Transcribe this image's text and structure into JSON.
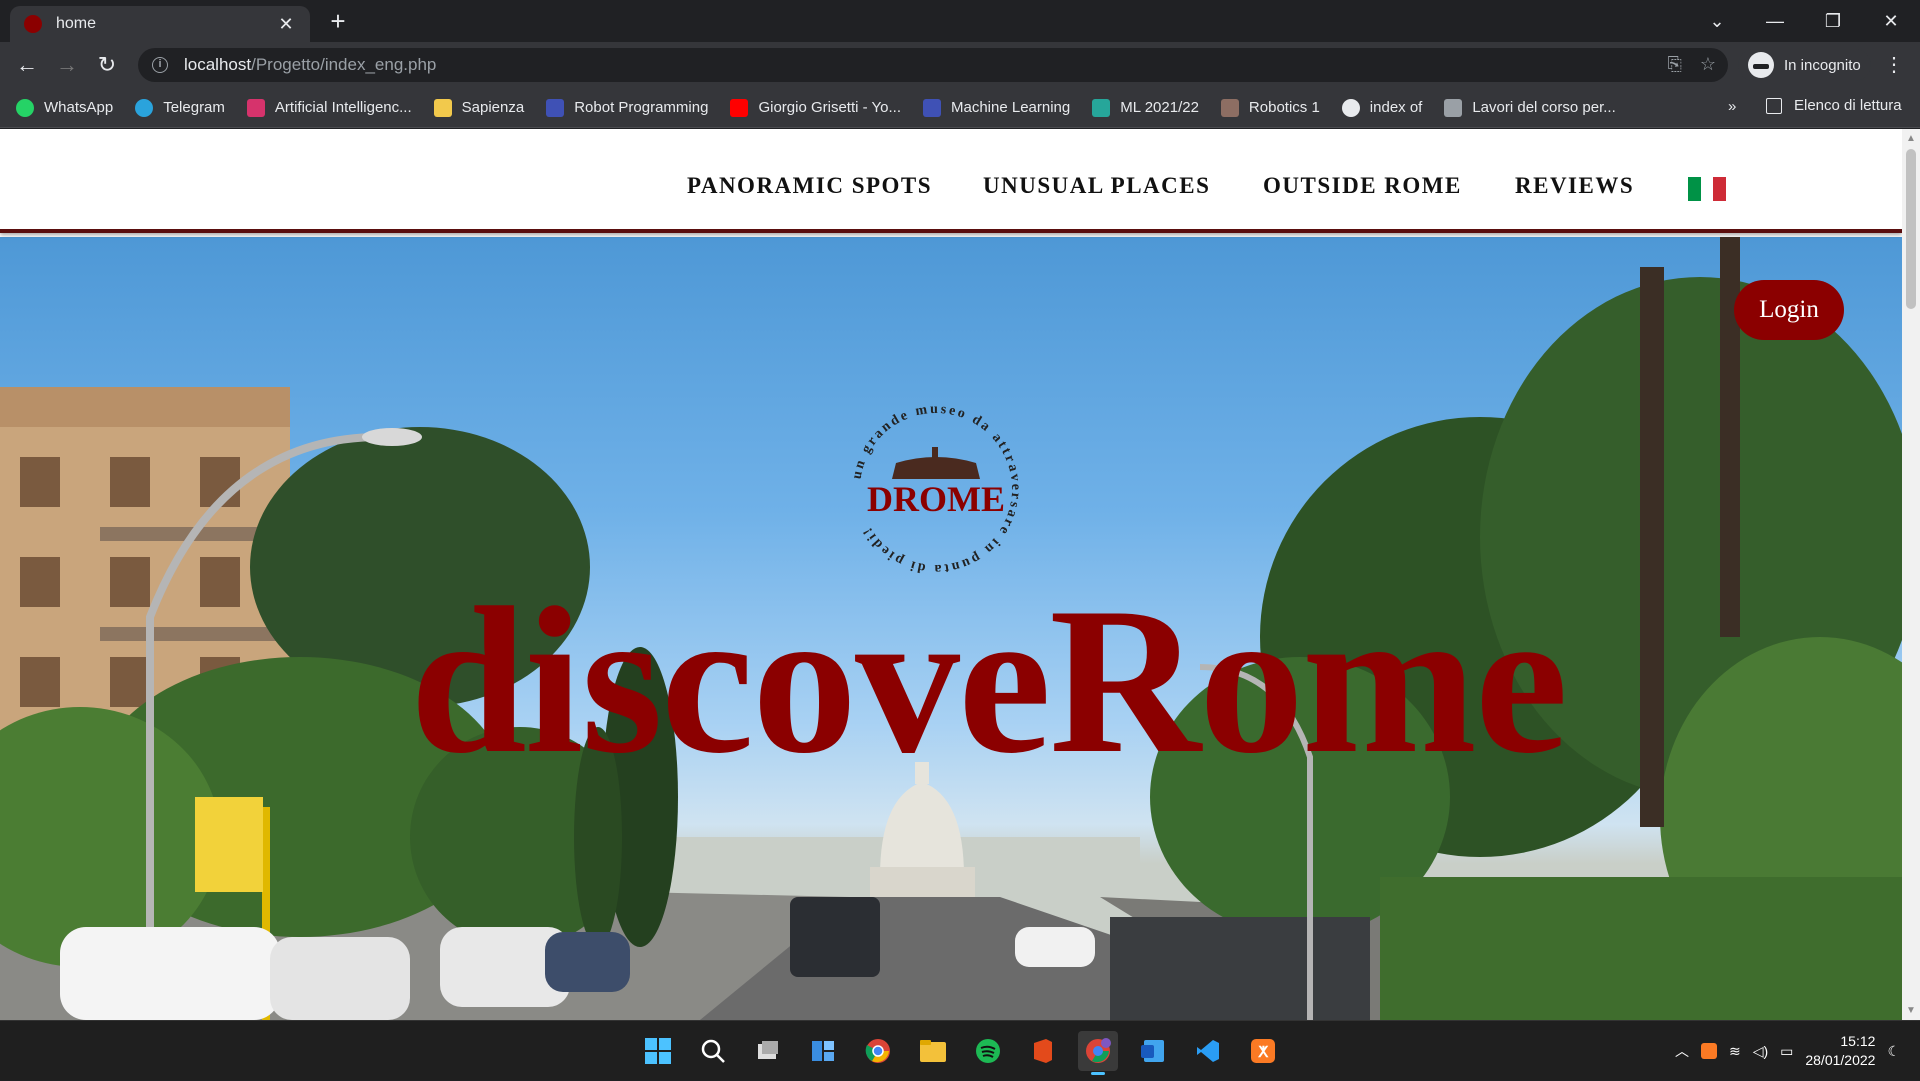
{
  "browser": {
    "tab_title": "home",
    "url_host": "localhost",
    "url_path": "/Progetto/index_eng.php",
    "incognito_label": "In incognito",
    "bookmarks": [
      {
        "label": "WhatsApp",
        "color": "#25d366"
      },
      {
        "label": "Telegram",
        "color": "#2aa3dc"
      },
      {
        "label": "Artificial Intelligenc...",
        "color": "#d6336c"
      },
      {
        "label": "Sapienza",
        "color": "#f2c94c"
      },
      {
        "label": "Robot Programming",
        "color": "#3f51b5"
      },
      {
        "label": "Giorgio Grisetti - Yo...",
        "color": "#ff0000"
      },
      {
        "label": "Machine Learning",
        "color": "#3f51b5"
      },
      {
        "label": "ML 2021/22",
        "color": "#26a69a"
      },
      {
        "label": "Robotics 1",
        "color": "#8d6e63"
      },
      {
        "label": "index of",
        "color": "#e8eaed"
      },
      {
        "label": "Lavori del corso per...",
        "color": "#9aa0a6"
      }
    ],
    "bookmarks_overflow": "»",
    "reading_list": "Elenco di lettura"
  },
  "site": {
    "nav": {
      "panoramic": "PANORAMIC SPOTS",
      "unusual": "UNUSUAL PLACES",
      "outside": "OUTSIDE ROME",
      "reviews": "REVIEWS"
    },
    "login_label": "Login",
    "logo_ring_text": "un grande museo da attraversare in punta di piedi!",
    "logo_word": "DROME",
    "hero_title": "discoveRome",
    "accent_color": "#8b0000",
    "flag_colors": [
      "#009246",
      "#ffffff",
      "#ce2b37"
    ]
  },
  "taskbar": {
    "time": "15:12",
    "date": "28/01/2022"
  }
}
